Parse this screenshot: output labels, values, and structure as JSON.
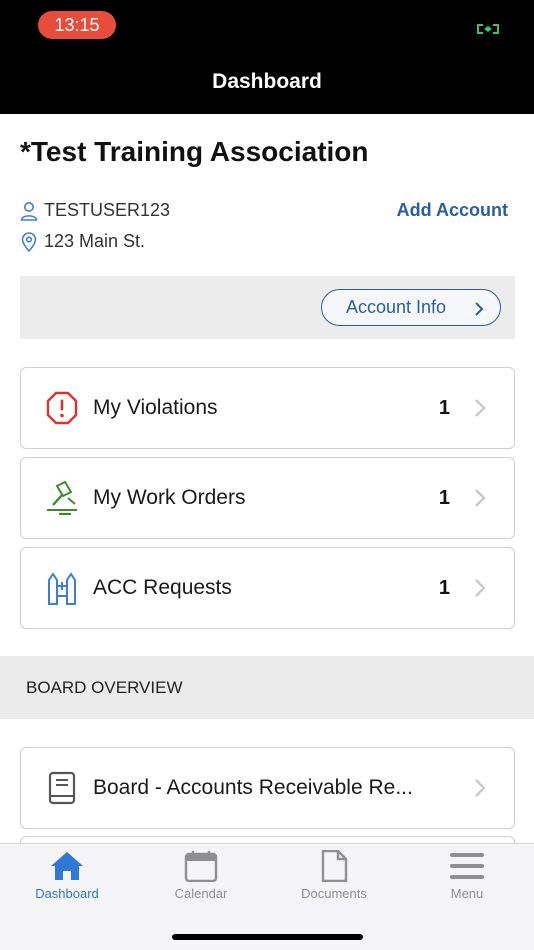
{
  "status_bar": {
    "time": "13:15"
  },
  "nav": {
    "title": "Dashboard"
  },
  "account": {
    "association_name": "*Test Training Association",
    "username": "TESTUSER123",
    "address": "123 Main St.",
    "add_account_label": "Add Account",
    "account_info_label": "Account Info"
  },
  "cards": [
    {
      "label": "My Violations",
      "count": "1",
      "icon": "violation-octagon-icon"
    },
    {
      "label": "My Work Orders",
      "count": "1",
      "icon": "hammer-icon"
    },
    {
      "label": "ACC Requests",
      "count": "1",
      "icon": "fence-icon"
    }
  ],
  "board": {
    "section_title": "BOARD OVERVIEW",
    "items": [
      {
        "label": "Board - Accounts Receivable Re...",
        "icon": "book-icon"
      }
    ]
  },
  "tabs": [
    {
      "label": "Dashboard",
      "icon": "home-icon",
      "active": true
    },
    {
      "label": "Calendar",
      "icon": "calendar-icon",
      "active": false
    },
    {
      "label": "Documents",
      "icon": "document-icon",
      "active": false
    },
    {
      "label": "Menu",
      "icon": "hamburger-icon",
      "active": false
    }
  ],
  "colors": {
    "accent": "#2a5f9e",
    "tab_active": "#2e78d6",
    "violation_red": "#d9362b",
    "work_order_green": "#3c8a2e",
    "acc_blue": "#3f7fd0",
    "time_pill": "#e74c3c"
  }
}
